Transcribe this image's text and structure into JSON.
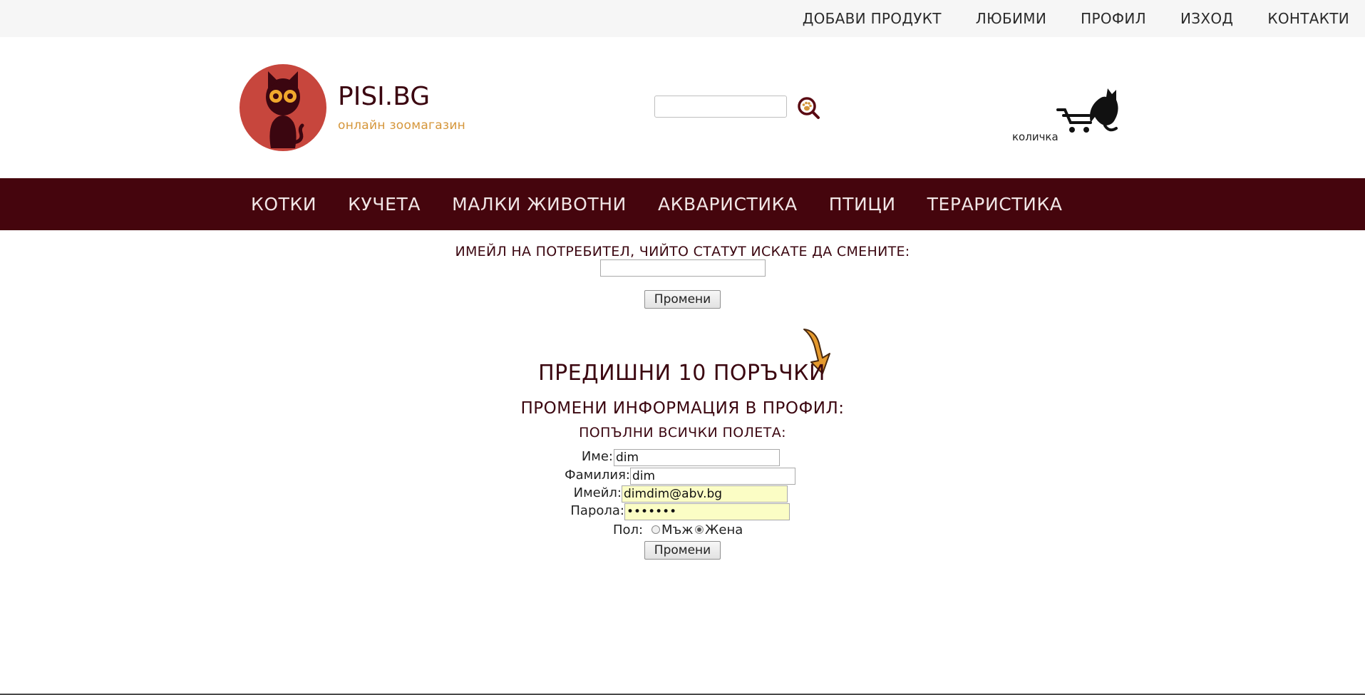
{
  "topnav": {
    "add_product": "ДОБАВИ ПРОДУКТ",
    "favorites": "ЛЮБИМИ",
    "profile": "ПРОФИЛ",
    "logout": "ИЗХОД",
    "contacts": "КОНТАКТИ"
  },
  "brand": {
    "title": "PISI.BG",
    "subtitle": "онлайн зоомагазин"
  },
  "search": {
    "value": "",
    "icon": "paw-search-icon"
  },
  "cart": {
    "label": "количка",
    "icon": "cat-shopping-cart-icon"
  },
  "mainnav": [
    "КОТКИ",
    "КУЧЕТА",
    "МАЛКИ ЖИВОТНИ",
    "АКВАРИСТИКА",
    "ПТИЦИ",
    "ТЕРАРИСТИКА"
  ],
  "status_form": {
    "label": "ИМЕЙЛ НА ПОТРЕБИТЕЛ, ЧИЙТО СТАТУТ ИСКАТЕ ДА СМЕНИТЕ:",
    "value": "",
    "button": "Промени"
  },
  "orders": {
    "title": "ПРЕДИШНИ 10 ПОРЪЧКИ"
  },
  "profile_form": {
    "title": "ПРОМЕНИ ИНФОРМАЦИЯ В ПРОФИЛ:",
    "subtitle": "ПОПЪЛНИ ВСИЧКИ ПОЛЕТА:",
    "first_name_label": "Име:",
    "first_name_value": "dim",
    "last_name_label": "Фамилия:",
    "last_name_value": "dim",
    "email_label": "Имейл:",
    "email_value": "dimdim@abv.bg",
    "password_label": "Парола:",
    "password_value": "•••••••",
    "gender_label": "Пол:",
    "gender_male": "Мъж",
    "gender_female": "Жена",
    "selected_gender": "Жена",
    "button": "Промени"
  },
  "colors": {
    "nav_bg": "#45050d",
    "brand_text": "#3b0610",
    "logo_bg": "#c7463d",
    "accent_orange": "#d5963a",
    "autofill_bg": "#fbfdc5"
  }
}
